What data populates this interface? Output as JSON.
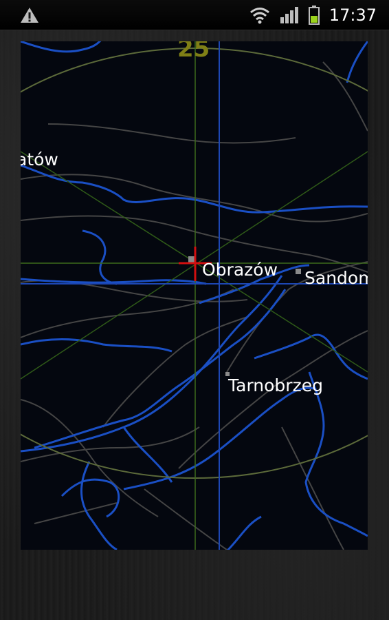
{
  "status_bar": {
    "time": "17:37",
    "icons": [
      "warning-icon",
      "wifi-icon",
      "signal-icon",
      "battery-icon"
    ]
  },
  "map": {
    "range_ring_label": "25",
    "places": [
      {
        "id": "city-partial-left",
        "name": "atów"
      },
      {
        "id": "city-obrazow",
        "name": "Obrazów"
      },
      {
        "id": "city-sandomierz",
        "name": "Sandom"
      },
      {
        "id": "city-tarnobrzeg",
        "name": "Tarnobrzeg"
      }
    ],
    "colors": {
      "background": "#04070f",
      "rivers": "#1a4fc4",
      "roads": "#444444",
      "grid": "#3c6a1c",
      "range_ring": "#5c6a3a",
      "bearing_line": "#1d47b4",
      "marker": "#d10f0f",
      "range_label": "#7f7f16"
    }
  }
}
